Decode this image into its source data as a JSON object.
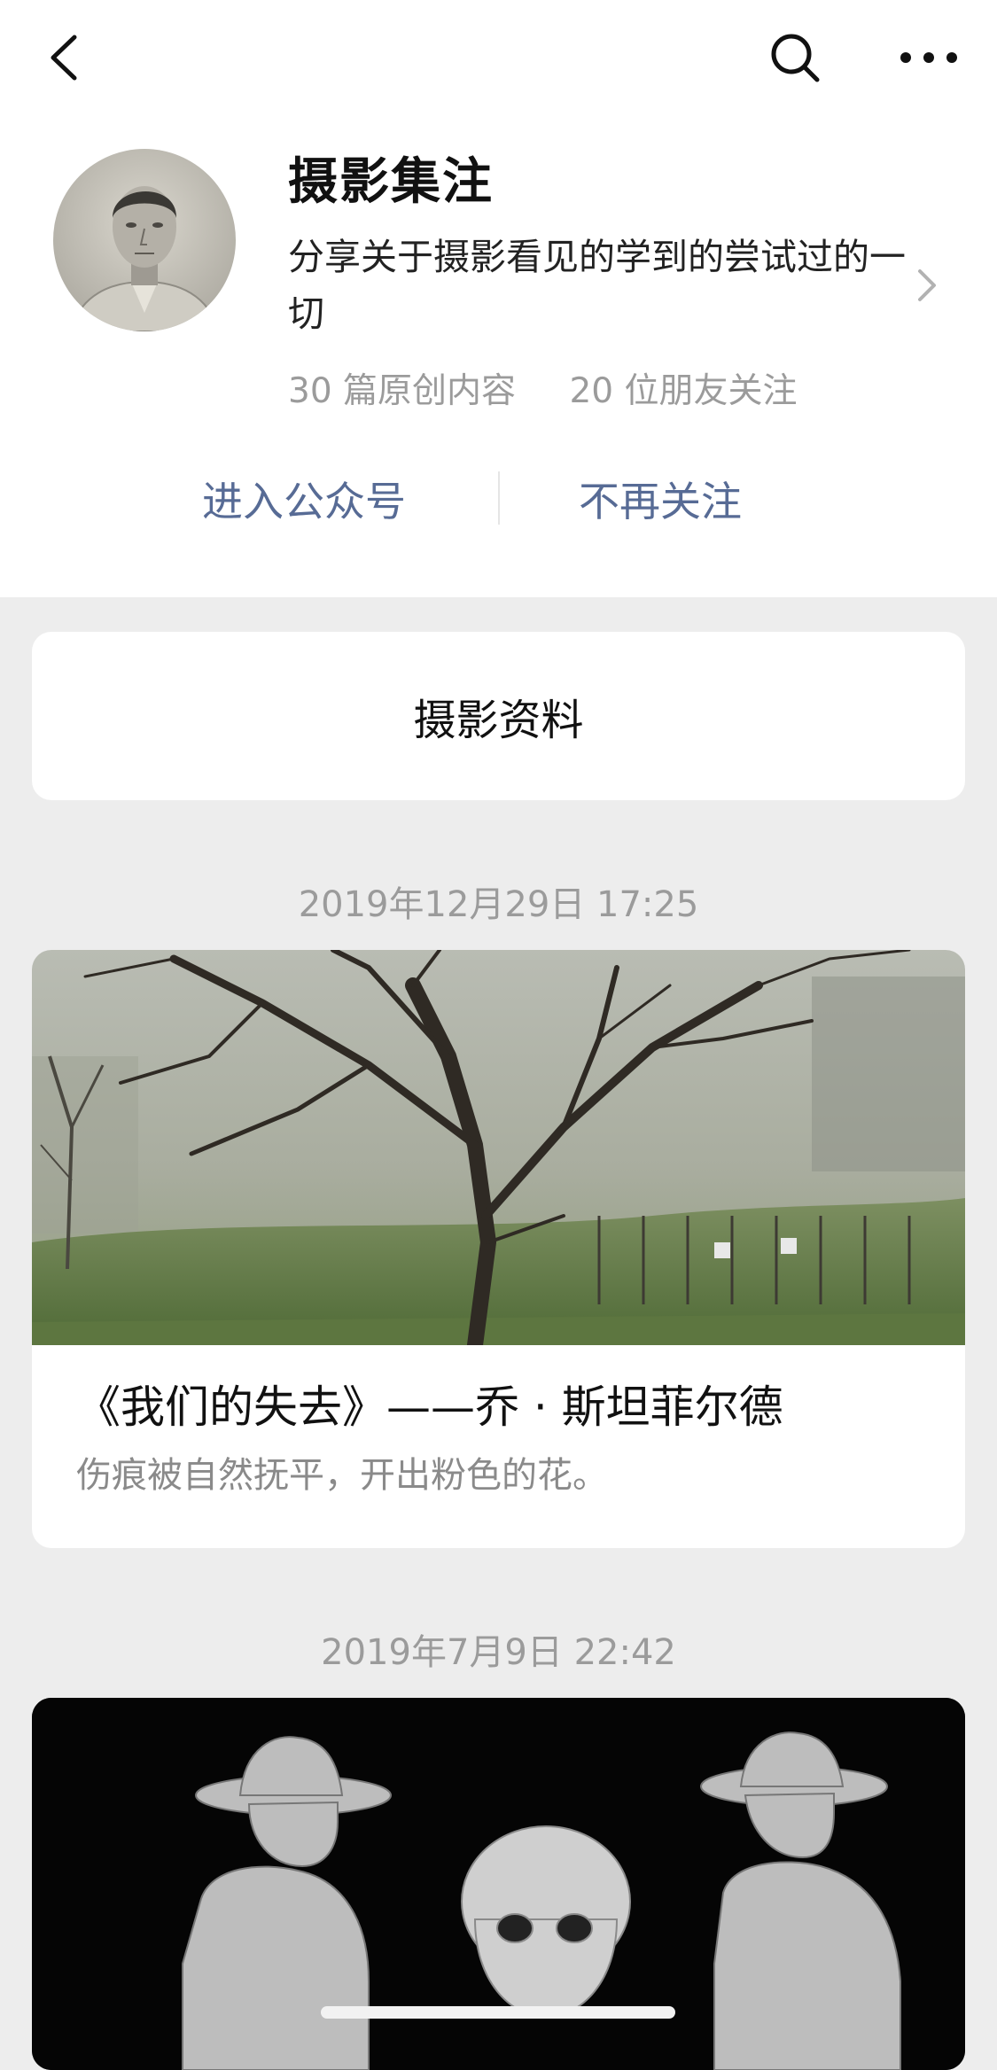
{
  "nav": {
    "back_icon": "chevron-left-icon",
    "search_icon": "search-icon",
    "more_icon": "more-dots-icon"
  },
  "account": {
    "name": "摄影集注",
    "description": "分享关于摄影看见的学到的尝试过的一切",
    "stats": [
      "30 篇原创内容",
      "20 位朋友关注"
    ],
    "avatar_icon": "avatar-portrait"
  },
  "actions": {
    "enter": "进入公众号",
    "unfollow": "不再关注"
  },
  "menu": {
    "label": "摄影资料"
  },
  "articles": [
    {
      "date": "2019年12月29日 17:25",
      "title": "《我们的失去》——乔 · 斯坦菲尔德",
      "subtitle": "伤痕被自然抚平，开出粉色的花。"
    },
    {
      "date": "2019年7月9日 22:42"
    }
  ],
  "colors": {
    "link": "#576b95",
    "muted": "#9b9b9b",
    "background": "#ededed"
  }
}
